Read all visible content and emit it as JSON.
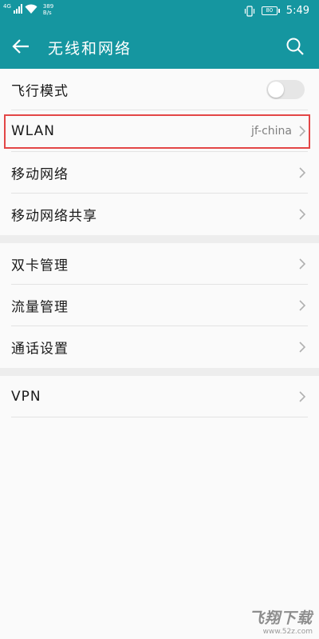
{
  "status_bar": {
    "network_type": "4G",
    "speed_value": "389",
    "speed_unit": "B/s",
    "battery_level": "80",
    "time": "5:49",
    "icons": [
      "signal-icon",
      "wifi-icon",
      "vibrate-icon",
      "battery-icon"
    ]
  },
  "app_bar": {
    "title": "无线和网络",
    "back_icon": "arrow-left-icon",
    "search_icon": "search-icon"
  },
  "colors": {
    "header": "#1596a0",
    "highlight": "#e34646",
    "background": "#fafafa",
    "separator": "#ededed"
  },
  "section1": {
    "airplane": {
      "label": "飞行模式",
      "toggle_on": false
    },
    "wlan": {
      "label": "WLAN",
      "value": "jf-china"
    },
    "mobile_network": {
      "label": "移动网络"
    },
    "tethering": {
      "label": "移动网络共享"
    }
  },
  "section2": {
    "dual_sim": {
      "label": "双卡管理"
    },
    "data_usage": {
      "label": "流量管理"
    },
    "call_settings": {
      "label": "通话设置"
    }
  },
  "section3": {
    "vpn": {
      "label": "VPN"
    }
  },
  "watermark": {
    "logo": "飞翔下载",
    "url": "www.52z.com"
  }
}
